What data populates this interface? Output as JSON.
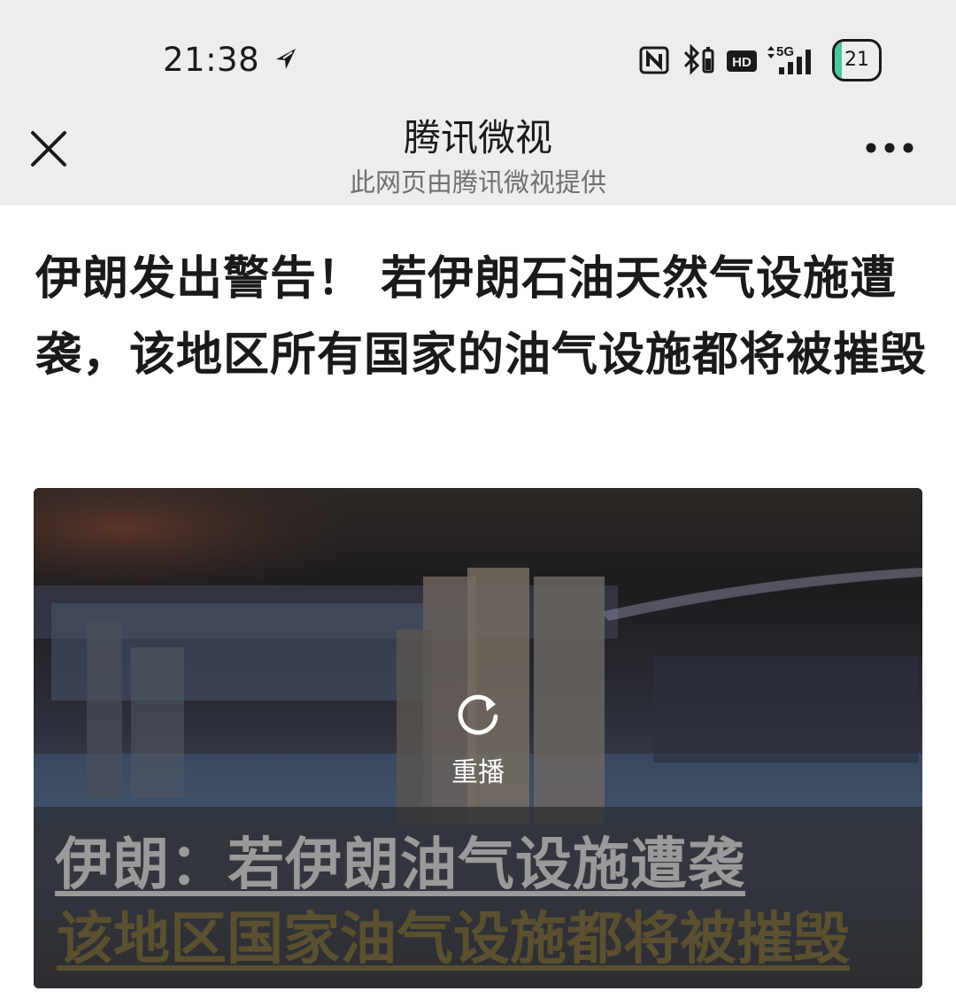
{
  "status_bar": {
    "time": "21:38",
    "battery_level": "21",
    "icons": [
      "location-arrow-icon",
      "nfc-icon",
      "bluetooth-icon",
      "hd-icon",
      "5g-signal-icon",
      "battery-icon"
    ]
  },
  "header": {
    "title": "腾讯微视",
    "subtitle": "此网页由腾讯微视提供",
    "close_icon": "close-icon",
    "more_icon": "more-icon"
  },
  "article": {
    "headline": "伊朗发出警告！ 若伊朗石油天然气设施遭袭，该地区所有国家的油气设施都将被摧毁"
  },
  "video": {
    "replay_label": "重播",
    "caption_line1": "伊朗：若伊朗油气设施遭袭",
    "caption_line2": "该地区国家油气设施都将被摧毁"
  },
  "colors": {
    "topbar_bg": "#ededed",
    "text_primary": "#1a1a1a",
    "text_secondary": "#6f6f6f",
    "battery_accent": "#4cc79a"
  }
}
